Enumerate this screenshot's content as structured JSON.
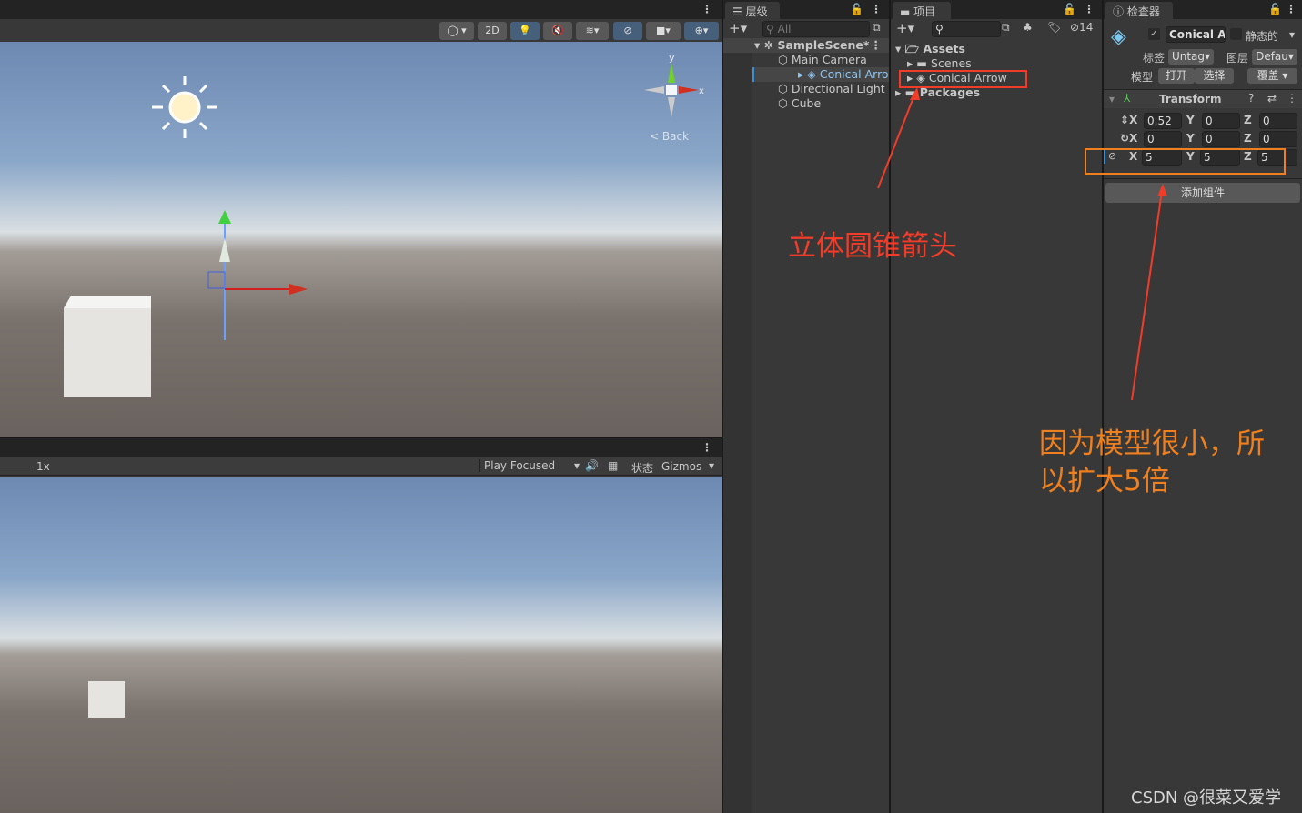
{
  "scene": {
    "toolbar": {
      "mode_2d": "2D"
    },
    "gizmo": {
      "y_label": "y",
      "x_label": "x",
      "back_label": "Back"
    }
  },
  "game": {
    "scale_label": "1x",
    "play_mode": "Play Focused",
    "stats_label": "状态",
    "gizmos_label": "Gizmos"
  },
  "hierarchy": {
    "tab": "层级",
    "search_placeholder": "All",
    "scene_name": "SampleScene*",
    "items": [
      {
        "label": "Main Camera"
      },
      {
        "label": "Conical Arrow"
      },
      {
        "label": "Directional Light"
      },
      {
        "label": "Cube"
      }
    ]
  },
  "project": {
    "tab": "项目",
    "hidden_count": "14",
    "items": [
      {
        "label": "Assets"
      },
      {
        "label": "Scenes"
      },
      {
        "label": "Conical Arrow"
      },
      {
        "label": "Packages"
      }
    ]
  },
  "inspector": {
    "tab": "检查器",
    "object_name": "Conical Ar",
    "static_label": "静态的",
    "tag_label": "标签",
    "tag_value": "Untag",
    "layer_label": "图层",
    "layer_value": "Defau",
    "model_label": "模型",
    "open_label": "打开",
    "select_label": "选择",
    "overrides_label": "覆盖",
    "component": "Transform",
    "position": {
      "x": "0.52",
      "y": "0",
      "z": "0"
    },
    "rotation": {
      "x": "0",
      "y": "0",
      "z": "0"
    },
    "scale": {
      "x": "5",
      "y": "5",
      "z": "5"
    },
    "axis": {
      "x": "X",
      "y": "Y",
      "z": "Z"
    },
    "add_component": "添加组件"
  },
  "annotations": {
    "conical_arrow": "立体圆锥箭头",
    "scale_note_1": "因为模型很小，所",
    "scale_note_2": "以扩大5倍"
  },
  "watermark": "CSDN @很菜又爱学",
  "colors": {
    "annotation_red": "#f23c2a",
    "highlight_orange": "#f0801e",
    "selection_blue": "#2c5d87"
  }
}
